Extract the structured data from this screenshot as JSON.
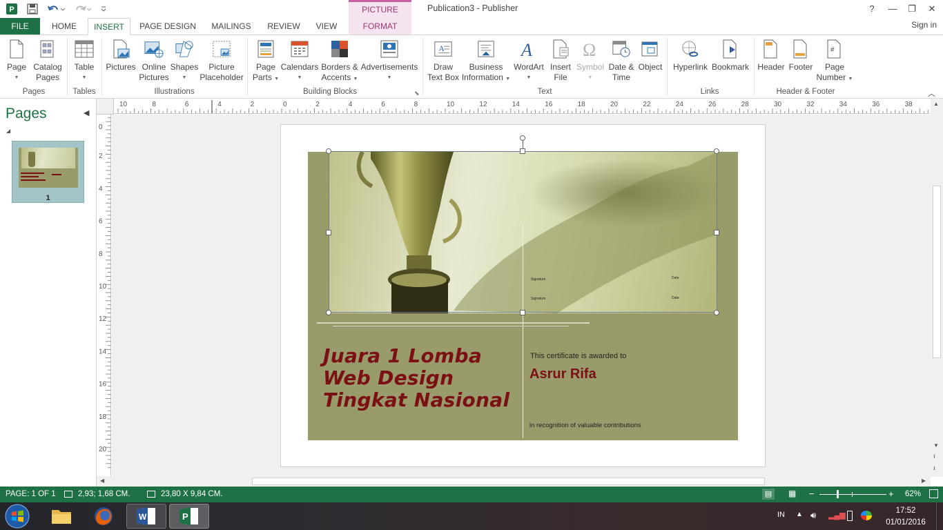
{
  "window": {
    "title": "Publication3 - Publisher",
    "picture_tools": "PICTURE TOOLS",
    "help": "?",
    "minimize": "—",
    "restore": "❐",
    "close": "✕"
  },
  "tabs": [
    "FILE",
    "HOME",
    "INSERT",
    "PAGE DESIGN",
    "MAILINGS",
    "REVIEW",
    "VIEW",
    "FORMAT"
  ],
  "signin": "Sign in",
  "ribbon": {
    "page": "Page",
    "catalog": [
      "Catalog",
      "Pages"
    ],
    "table": "Table",
    "pictures": "Pictures",
    "online_pictures": [
      "Online",
      "Pictures"
    ],
    "shapes": "Shapes",
    "picture_placeholder": [
      "Picture",
      "Placeholder"
    ],
    "page_parts": [
      "Page",
      "Parts"
    ],
    "calendars": "Calendars",
    "borders_accents": [
      "Borders &",
      "Accents"
    ],
    "advertisements": "Advertisements",
    "draw_text_box": [
      "Draw",
      "Text Box"
    ],
    "business_info": [
      "Business",
      "Information"
    ],
    "wordart": "WordArt",
    "insert_file": [
      "Insert",
      "File"
    ],
    "symbol": "Symbol",
    "date_time": [
      "Date &",
      "Time"
    ],
    "object": "Object",
    "hyperlink": "Hyperlink",
    "bookmark": "Bookmark",
    "header": "Header",
    "footer": "Footer",
    "page_number": [
      "Page",
      "Number"
    ],
    "groups": {
      "pages": "Pages",
      "tables": "Tables",
      "illustrations": "Illustrations",
      "building_blocks": "Building Blocks",
      "text": "Text",
      "links": "Links",
      "header_footer": "Header & Footer"
    }
  },
  "pages_pane": {
    "title": "Pages",
    "page_number": "1"
  },
  "rulers": {
    "horizontal": [
      "10",
      "8",
      "6",
      "4",
      "2",
      "0",
      "2",
      "4",
      "6",
      "8",
      "10",
      "12",
      "14",
      "16",
      "18",
      "20",
      "22",
      "24",
      "26",
      "28",
      "30",
      "32",
      "34",
      "36",
      "38"
    ],
    "vertical": [
      "0",
      "2",
      "4",
      "6",
      "8",
      "10",
      "12",
      "14",
      "16",
      "18",
      "20"
    ]
  },
  "certificate": {
    "title_lines": [
      "Juara 1 Lomba",
      "Web Design",
      "Tingkat Nasional"
    ],
    "awarded_to": "This certificate is awarded to",
    "recipient": "Asrur Rifa",
    "recognition": "in recognition of valuable contributions",
    "signature": "Signature",
    "date": "Date"
  },
  "status": {
    "page": "PAGE: 1 OF 1",
    "position": "2,93; 1,68 CM.",
    "size": "23,80 X  9,84 CM.",
    "zoom": "62%"
  },
  "taskbar": {
    "language": "IN",
    "time": "17:52",
    "date": "01/01/2016"
  }
}
